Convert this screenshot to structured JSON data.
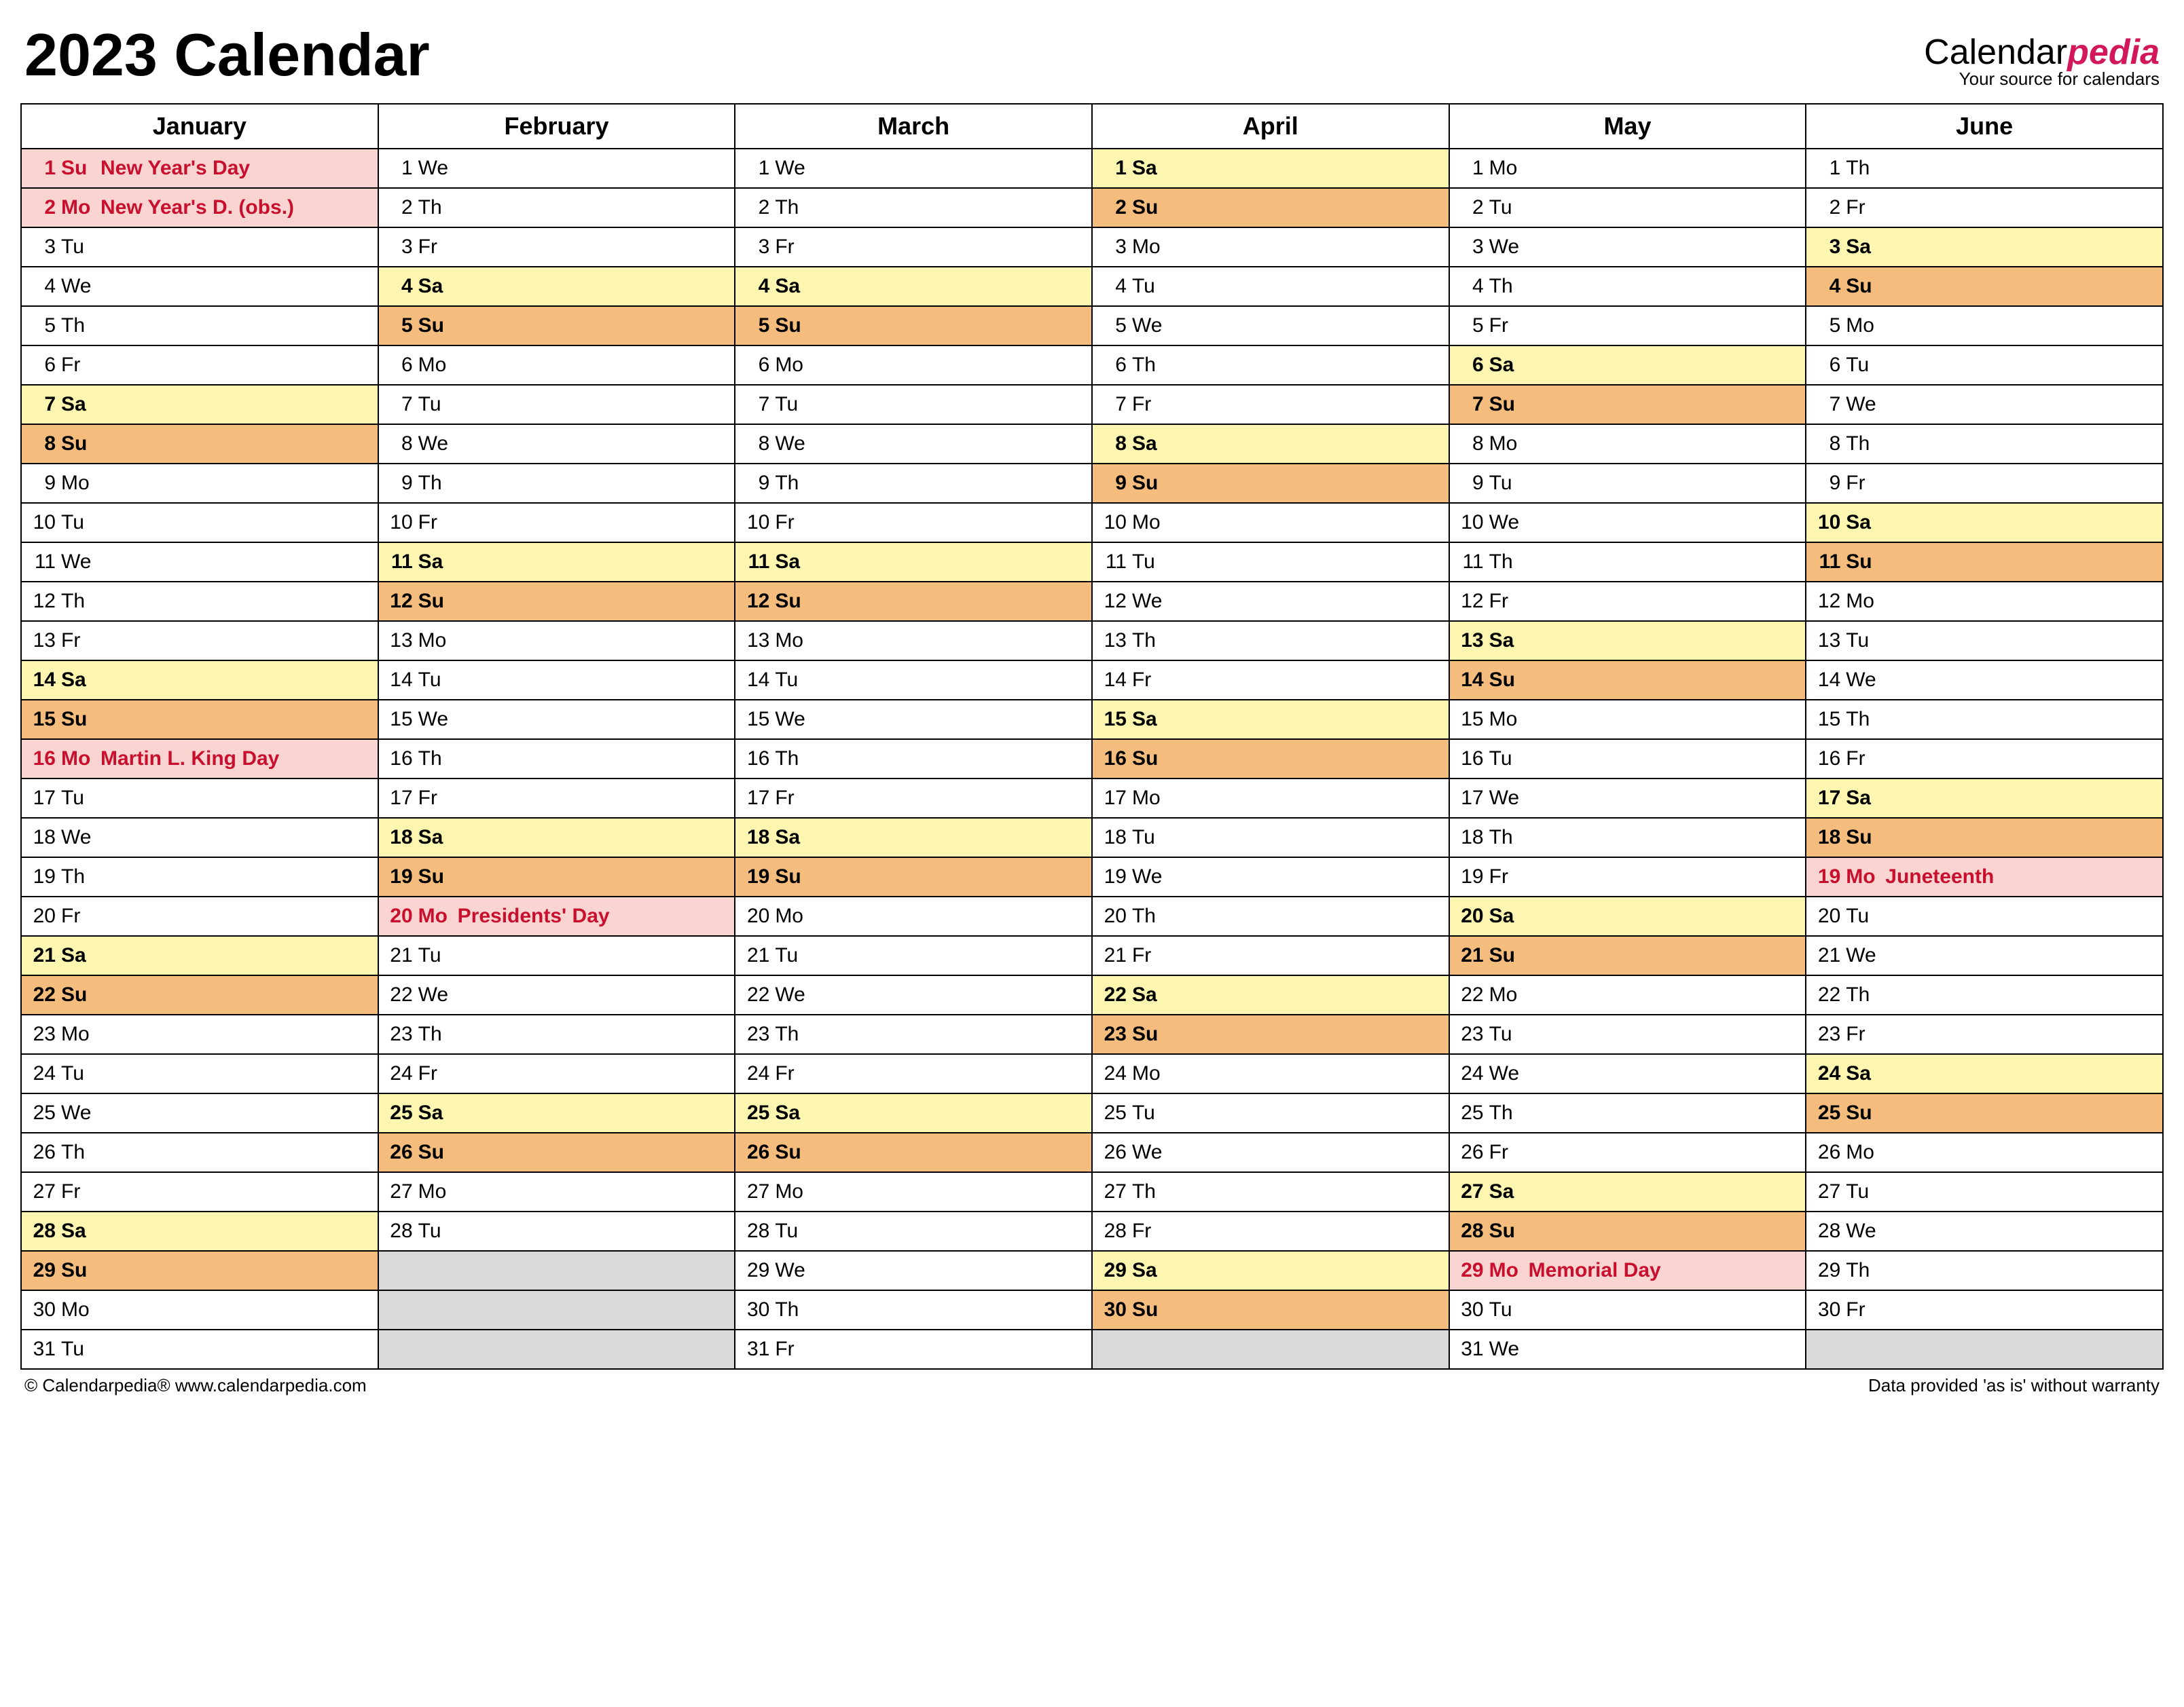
{
  "title": "2023 Calendar",
  "brand": {
    "name_prefix": "Calendar",
    "name_accent": "pedia",
    "tagline": "Your source for calendars"
  },
  "footer": {
    "left": "© Calendarpedia®   www.calendarpedia.com",
    "right": "Data provided 'as is' without warranty"
  },
  "months": [
    "January",
    "February",
    "March",
    "April",
    "May",
    "June"
  ],
  "rows": [
    [
      {
        "n": 1,
        "d": "Su",
        "t": "sun",
        "h": "New Year's Day",
        "hol": true
      },
      {
        "n": 1,
        "d": "We",
        "t": ""
      },
      {
        "n": 1,
        "d": "We",
        "t": ""
      },
      {
        "n": 1,
        "d": "Sa",
        "t": "sat"
      },
      {
        "n": 1,
        "d": "Mo",
        "t": ""
      },
      {
        "n": 1,
        "d": "Th",
        "t": ""
      }
    ],
    [
      {
        "n": 2,
        "d": "Mo",
        "t": "",
        "h": "New Year's D. (obs.)",
        "hol": true
      },
      {
        "n": 2,
        "d": "Th",
        "t": ""
      },
      {
        "n": 2,
        "d": "Th",
        "t": ""
      },
      {
        "n": 2,
        "d": "Su",
        "t": "sun"
      },
      {
        "n": 2,
        "d": "Tu",
        "t": ""
      },
      {
        "n": 2,
        "d": "Fr",
        "t": ""
      }
    ],
    [
      {
        "n": 3,
        "d": "Tu",
        "t": ""
      },
      {
        "n": 3,
        "d": "Fr",
        "t": ""
      },
      {
        "n": 3,
        "d": "Fr",
        "t": ""
      },
      {
        "n": 3,
        "d": "Mo",
        "t": ""
      },
      {
        "n": 3,
        "d": "We",
        "t": ""
      },
      {
        "n": 3,
        "d": "Sa",
        "t": "sat"
      }
    ],
    [
      {
        "n": 4,
        "d": "We",
        "t": ""
      },
      {
        "n": 4,
        "d": "Sa",
        "t": "sat"
      },
      {
        "n": 4,
        "d": "Sa",
        "t": "sat"
      },
      {
        "n": 4,
        "d": "Tu",
        "t": ""
      },
      {
        "n": 4,
        "d": "Th",
        "t": ""
      },
      {
        "n": 4,
        "d": "Su",
        "t": "sun"
      }
    ],
    [
      {
        "n": 5,
        "d": "Th",
        "t": ""
      },
      {
        "n": 5,
        "d": "Su",
        "t": "sun"
      },
      {
        "n": 5,
        "d": "Su",
        "t": "sun"
      },
      {
        "n": 5,
        "d": "We",
        "t": ""
      },
      {
        "n": 5,
        "d": "Fr",
        "t": ""
      },
      {
        "n": 5,
        "d": "Mo",
        "t": ""
      }
    ],
    [
      {
        "n": 6,
        "d": "Fr",
        "t": ""
      },
      {
        "n": 6,
        "d": "Mo",
        "t": ""
      },
      {
        "n": 6,
        "d": "Mo",
        "t": ""
      },
      {
        "n": 6,
        "d": "Th",
        "t": ""
      },
      {
        "n": 6,
        "d": "Sa",
        "t": "sat"
      },
      {
        "n": 6,
        "d": "Tu",
        "t": ""
      }
    ],
    [
      {
        "n": 7,
        "d": "Sa",
        "t": "sat"
      },
      {
        "n": 7,
        "d": "Tu",
        "t": ""
      },
      {
        "n": 7,
        "d": "Tu",
        "t": ""
      },
      {
        "n": 7,
        "d": "Fr",
        "t": ""
      },
      {
        "n": 7,
        "d": "Su",
        "t": "sun"
      },
      {
        "n": 7,
        "d": "We",
        "t": ""
      }
    ],
    [
      {
        "n": 8,
        "d": "Su",
        "t": "sun"
      },
      {
        "n": 8,
        "d": "We",
        "t": ""
      },
      {
        "n": 8,
        "d": "We",
        "t": ""
      },
      {
        "n": 8,
        "d": "Sa",
        "t": "sat"
      },
      {
        "n": 8,
        "d": "Mo",
        "t": ""
      },
      {
        "n": 8,
        "d": "Th",
        "t": ""
      }
    ],
    [
      {
        "n": 9,
        "d": "Mo",
        "t": ""
      },
      {
        "n": 9,
        "d": "Th",
        "t": ""
      },
      {
        "n": 9,
        "d": "Th",
        "t": ""
      },
      {
        "n": 9,
        "d": "Su",
        "t": "sun"
      },
      {
        "n": 9,
        "d": "Tu",
        "t": ""
      },
      {
        "n": 9,
        "d": "Fr",
        "t": ""
      }
    ],
    [
      {
        "n": 10,
        "d": "Tu",
        "t": ""
      },
      {
        "n": 10,
        "d": "Fr",
        "t": ""
      },
      {
        "n": 10,
        "d": "Fr",
        "t": ""
      },
      {
        "n": 10,
        "d": "Mo",
        "t": ""
      },
      {
        "n": 10,
        "d": "We",
        "t": ""
      },
      {
        "n": 10,
        "d": "Sa",
        "t": "sat"
      }
    ],
    [
      {
        "n": 11,
        "d": "We",
        "t": ""
      },
      {
        "n": 11,
        "d": "Sa",
        "t": "sat"
      },
      {
        "n": 11,
        "d": "Sa",
        "t": "sat"
      },
      {
        "n": 11,
        "d": "Tu",
        "t": ""
      },
      {
        "n": 11,
        "d": "Th",
        "t": ""
      },
      {
        "n": 11,
        "d": "Su",
        "t": "sun"
      }
    ],
    [
      {
        "n": 12,
        "d": "Th",
        "t": ""
      },
      {
        "n": 12,
        "d": "Su",
        "t": "sun"
      },
      {
        "n": 12,
        "d": "Su",
        "t": "sun"
      },
      {
        "n": 12,
        "d": "We",
        "t": ""
      },
      {
        "n": 12,
        "d": "Fr",
        "t": ""
      },
      {
        "n": 12,
        "d": "Mo",
        "t": ""
      }
    ],
    [
      {
        "n": 13,
        "d": "Fr",
        "t": ""
      },
      {
        "n": 13,
        "d": "Mo",
        "t": ""
      },
      {
        "n": 13,
        "d": "Mo",
        "t": ""
      },
      {
        "n": 13,
        "d": "Th",
        "t": ""
      },
      {
        "n": 13,
        "d": "Sa",
        "t": "sat"
      },
      {
        "n": 13,
        "d": "Tu",
        "t": ""
      }
    ],
    [
      {
        "n": 14,
        "d": "Sa",
        "t": "sat"
      },
      {
        "n": 14,
        "d": "Tu",
        "t": ""
      },
      {
        "n": 14,
        "d": "Tu",
        "t": ""
      },
      {
        "n": 14,
        "d": "Fr",
        "t": ""
      },
      {
        "n": 14,
        "d": "Su",
        "t": "sun"
      },
      {
        "n": 14,
        "d": "We",
        "t": ""
      }
    ],
    [
      {
        "n": 15,
        "d": "Su",
        "t": "sun"
      },
      {
        "n": 15,
        "d": "We",
        "t": ""
      },
      {
        "n": 15,
        "d": "We",
        "t": ""
      },
      {
        "n": 15,
        "d": "Sa",
        "t": "sat"
      },
      {
        "n": 15,
        "d": "Mo",
        "t": ""
      },
      {
        "n": 15,
        "d": "Th",
        "t": ""
      }
    ],
    [
      {
        "n": 16,
        "d": "Mo",
        "t": "",
        "h": "Martin L. King Day",
        "hol": true
      },
      {
        "n": 16,
        "d": "Th",
        "t": ""
      },
      {
        "n": 16,
        "d": "Th",
        "t": ""
      },
      {
        "n": 16,
        "d": "Su",
        "t": "sun"
      },
      {
        "n": 16,
        "d": "Tu",
        "t": ""
      },
      {
        "n": 16,
        "d": "Fr",
        "t": ""
      }
    ],
    [
      {
        "n": 17,
        "d": "Tu",
        "t": ""
      },
      {
        "n": 17,
        "d": "Fr",
        "t": ""
      },
      {
        "n": 17,
        "d": "Fr",
        "t": ""
      },
      {
        "n": 17,
        "d": "Mo",
        "t": ""
      },
      {
        "n": 17,
        "d": "We",
        "t": ""
      },
      {
        "n": 17,
        "d": "Sa",
        "t": "sat"
      }
    ],
    [
      {
        "n": 18,
        "d": "We",
        "t": ""
      },
      {
        "n": 18,
        "d": "Sa",
        "t": "sat"
      },
      {
        "n": 18,
        "d": "Sa",
        "t": "sat"
      },
      {
        "n": 18,
        "d": "Tu",
        "t": ""
      },
      {
        "n": 18,
        "d": "Th",
        "t": ""
      },
      {
        "n": 18,
        "d": "Su",
        "t": "sun"
      }
    ],
    [
      {
        "n": 19,
        "d": "Th",
        "t": ""
      },
      {
        "n": 19,
        "d": "Su",
        "t": "sun"
      },
      {
        "n": 19,
        "d": "Su",
        "t": "sun"
      },
      {
        "n": 19,
        "d": "We",
        "t": ""
      },
      {
        "n": 19,
        "d": "Fr",
        "t": ""
      },
      {
        "n": 19,
        "d": "Mo",
        "t": "",
        "h": "Juneteenth",
        "hol": true
      }
    ],
    [
      {
        "n": 20,
        "d": "Fr",
        "t": ""
      },
      {
        "n": 20,
        "d": "Mo",
        "t": "",
        "h": "Presidents' Day",
        "hol": true
      },
      {
        "n": 20,
        "d": "Mo",
        "t": ""
      },
      {
        "n": 20,
        "d": "Th",
        "t": ""
      },
      {
        "n": 20,
        "d": "Sa",
        "t": "sat"
      },
      {
        "n": 20,
        "d": "Tu",
        "t": ""
      }
    ],
    [
      {
        "n": 21,
        "d": "Sa",
        "t": "sat"
      },
      {
        "n": 21,
        "d": "Tu",
        "t": ""
      },
      {
        "n": 21,
        "d": "Tu",
        "t": ""
      },
      {
        "n": 21,
        "d": "Fr",
        "t": ""
      },
      {
        "n": 21,
        "d": "Su",
        "t": "sun"
      },
      {
        "n": 21,
        "d": "We",
        "t": ""
      }
    ],
    [
      {
        "n": 22,
        "d": "Su",
        "t": "sun"
      },
      {
        "n": 22,
        "d": "We",
        "t": ""
      },
      {
        "n": 22,
        "d": "We",
        "t": ""
      },
      {
        "n": 22,
        "d": "Sa",
        "t": "sat"
      },
      {
        "n": 22,
        "d": "Mo",
        "t": ""
      },
      {
        "n": 22,
        "d": "Th",
        "t": ""
      }
    ],
    [
      {
        "n": 23,
        "d": "Mo",
        "t": ""
      },
      {
        "n": 23,
        "d": "Th",
        "t": ""
      },
      {
        "n": 23,
        "d": "Th",
        "t": ""
      },
      {
        "n": 23,
        "d": "Su",
        "t": "sun"
      },
      {
        "n": 23,
        "d": "Tu",
        "t": ""
      },
      {
        "n": 23,
        "d": "Fr",
        "t": ""
      }
    ],
    [
      {
        "n": 24,
        "d": "Tu",
        "t": ""
      },
      {
        "n": 24,
        "d": "Fr",
        "t": ""
      },
      {
        "n": 24,
        "d": "Fr",
        "t": ""
      },
      {
        "n": 24,
        "d": "Mo",
        "t": ""
      },
      {
        "n": 24,
        "d": "We",
        "t": ""
      },
      {
        "n": 24,
        "d": "Sa",
        "t": "sat"
      }
    ],
    [
      {
        "n": 25,
        "d": "We",
        "t": ""
      },
      {
        "n": 25,
        "d": "Sa",
        "t": "sat"
      },
      {
        "n": 25,
        "d": "Sa",
        "t": "sat"
      },
      {
        "n": 25,
        "d": "Tu",
        "t": ""
      },
      {
        "n": 25,
        "d": "Th",
        "t": ""
      },
      {
        "n": 25,
        "d": "Su",
        "t": "sun"
      }
    ],
    [
      {
        "n": 26,
        "d": "Th",
        "t": ""
      },
      {
        "n": 26,
        "d": "Su",
        "t": "sun"
      },
      {
        "n": 26,
        "d": "Su",
        "t": "sun"
      },
      {
        "n": 26,
        "d": "We",
        "t": ""
      },
      {
        "n": 26,
        "d": "Fr",
        "t": ""
      },
      {
        "n": 26,
        "d": "Mo",
        "t": ""
      }
    ],
    [
      {
        "n": 27,
        "d": "Fr",
        "t": ""
      },
      {
        "n": 27,
        "d": "Mo",
        "t": ""
      },
      {
        "n": 27,
        "d": "Mo",
        "t": ""
      },
      {
        "n": 27,
        "d": "Th",
        "t": ""
      },
      {
        "n": 27,
        "d": "Sa",
        "t": "sat"
      },
      {
        "n": 27,
        "d": "Tu",
        "t": ""
      }
    ],
    [
      {
        "n": 28,
        "d": "Sa",
        "t": "sat"
      },
      {
        "n": 28,
        "d": "Tu",
        "t": ""
      },
      {
        "n": 28,
        "d": "Tu",
        "t": ""
      },
      {
        "n": 28,
        "d": "Fr",
        "t": ""
      },
      {
        "n": 28,
        "d": "Su",
        "t": "sun"
      },
      {
        "n": 28,
        "d": "We",
        "t": ""
      }
    ],
    [
      {
        "n": 29,
        "d": "Su",
        "t": "sun"
      },
      {
        "blank": true
      },
      {
        "n": 29,
        "d": "We",
        "t": ""
      },
      {
        "n": 29,
        "d": "Sa",
        "t": "sat"
      },
      {
        "n": 29,
        "d": "Mo",
        "t": "",
        "h": "Memorial Day",
        "hol": true
      },
      {
        "n": 29,
        "d": "Th",
        "t": ""
      }
    ],
    [
      {
        "n": 30,
        "d": "Mo",
        "t": ""
      },
      {
        "blank": true
      },
      {
        "n": 30,
        "d": "Th",
        "t": ""
      },
      {
        "n": 30,
        "d": "Su",
        "t": "sun"
      },
      {
        "n": 30,
        "d": "Tu",
        "t": ""
      },
      {
        "n": 30,
        "d": "Fr",
        "t": ""
      }
    ],
    [
      {
        "n": 31,
        "d": "Tu",
        "t": ""
      },
      {
        "blank": true
      },
      {
        "n": 31,
        "d": "Fr",
        "t": ""
      },
      {
        "blank": true
      },
      {
        "n": 31,
        "d": "We",
        "t": ""
      },
      {
        "blank": true
      }
    ]
  ]
}
